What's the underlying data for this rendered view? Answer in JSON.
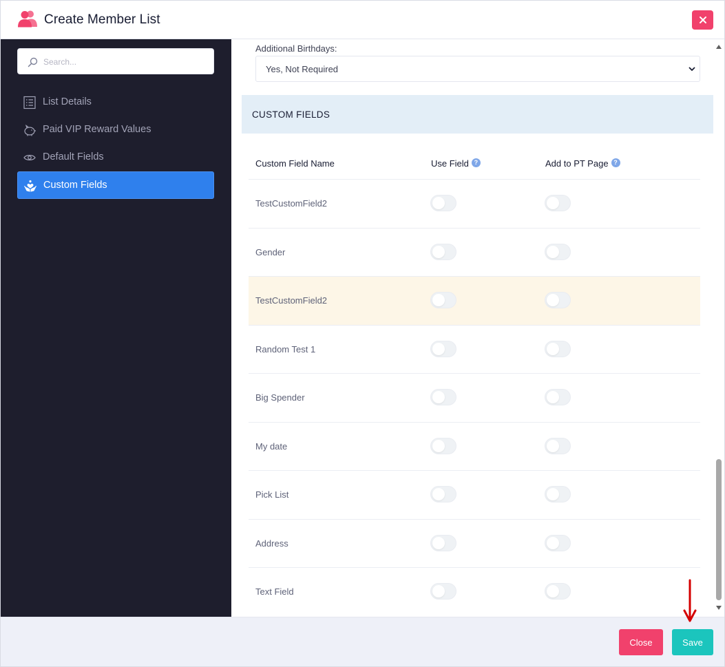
{
  "header": {
    "title": "Create Member List",
    "icon": "users-icon",
    "close_icon": "close-icon"
  },
  "sidebar": {
    "search": {
      "placeholder": "Search...",
      "value": ""
    },
    "items": [
      {
        "label": "List Details",
        "icon": "list-icon",
        "active": false
      },
      {
        "label": "Paid VIP Reward Values",
        "icon": "piggy-bank-icon",
        "active": false
      },
      {
        "label": "Default Fields",
        "icon": "eye-icon",
        "active": false
      },
      {
        "label": "Custom Fields",
        "icon": "hands-heart-icon",
        "active": true
      }
    ]
  },
  "main": {
    "additional_birthdays": {
      "label": "Additional Birthdays:",
      "selected": "Yes, Not Required"
    },
    "section_title": "CUSTOM FIELDS",
    "table": {
      "headers": [
        "Custom Field Name",
        "Use Field",
        "Add to PT Page"
      ],
      "help_glyph": "?",
      "rows": [
        {
          "name": "TestCustomField2",
          "use_field": false,
          "add_to_pt": false,
          "highlight": false
        },
        {
          "name": "Gender",
          "use_field": false,
          "add_to_pt": false,
          "highlight": false
        },
        {
          "name": "TestCustomField2",
          "use_field": false,
          "add_to_pt": false,
          "highlight": true
        },
        {
          "name": "Random Test 1",
          "use_field": false,
          "add_to_pt": false,
          "highlight": false
        },
        {
          "name": "Big Spender",
          "use_field": false,
          "add_to_pt": false,
          "highlight": false
        },
        {
          "name": "My date",
          "use_field": false,
          "add_to_pt": false,
          "highlight": false
        },
        {
          "name": "Pick List",
          "use_field": false,
          "add_to_pt": false,
          "highlight": false
        },
        {
          "name": "Address",
          "use_field": false,
          "add_to_pt": false,
          "highlight": false
        },
        {
          "name": "Text Field",
          "use_field": false,
          "add_to_pt": false,
          "highlight": false
        }
      ]
    }
  },
  "footer": {
    "close_label": "Close",
    "save_label": "Save"
  },
  "colors": {
    "accent_pink": "#f1416c",
    "accent_teal": "#1bc5bd",
    "sidebar_bg": "#1e1e2d",
    "active_blue": "#2f80ed",
    "section_bg": "#e3eef7",
    "highlight_row": "#fdf6e7",
    "annotation_arrow": "#d40000"
  }
}
